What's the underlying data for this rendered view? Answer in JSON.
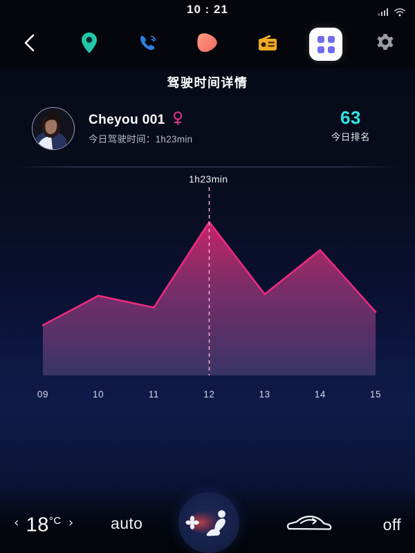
{
  "statusbar": {
    "time": "10 : 21",
    "signal_icon": "signal-bars-icon",
    "wifi_icon": "wifi-icon"
  },
  "topnav": {
    "items": [
      {
        "name": "back",
        "icon": "back-chevron-icon",
        "label": "",
        "color": "#ffffff",
        "active": false
      },
      {
        "name": "navigation",
        "icon": "location-pin-icon",
        "label": "",
        "color": "#22c7a9",
        "active": false
      },
      {
        "name": "phone",
        "icon": "phone-call-icon",
        "label": "",
        "color": "#2f7fe0",
        "active": false
      },
      {
        "name": "music",
        "icon": "music-plectrum-icon",
        "label": "",
        "color": "#f98676",
        "active": false
      },
      {
        "name": "radio",
        "icon": "radio-icon",
        "label": "",
        "color": "#f0ab25",
        "active": false
      },
      {
        "name": "apps",
        "icon": "apps-grid-icon",
        "label": "",
        "color": "#6f6cf0",
        "active": true
      },
      {
        "name": "settings",
        "icon": "gear-icon",
        "label": "",
        "color": "#9a9ba3",
        "active": false
      }
    ]
  },
  "header": {
    "title": "驾驶时间详情"
  },
  "user": {
    "avatar_alt": "user-avatar",
    "name": "Cheyou 001",
    "gender_icon": "female-gender-icon",
    "gender_color": "#e0338c",
    "drive_time_label": "今日驾驶时间：1h23min",
    "rank_value": "63",
    "rank_label": "今日排名",
    "rank_color": "#2fe4e4"
  },
  "chart_data": {
    "type": "area",
    "title": "",
    "xlabel": "",
    "ylabel": "",
    "categories": [
      "09",
      "10",
      "11",
      "12",
      "13",
      "14",
      "15"
    ],
    "values": [
      34,
      54,
      46,
      104,
      55,
      85,
      43
    ],
    "value_unit": "min",
    "ylim": [
      0,
      120
    ],
    "grid": false,
    "legend": false,
    "annotation": {
      "label": "1h23min",
      "at_category": "12",
      "marker": "dashed-vertical-line"
    },
    "line_color": "#ec2a7e",
    "fill_top_color": "#d8256f",
    "fill_bottom_color": "#4a3f72"
  },
  "climate": {
    "temp_prev_icon": "chevron-left-icon",
    "temp_value": "18",
    "temp_unit": "°C",
    "temp_next_icon": "chevron-right-icon",
    "auto_label": "auto",
    "fan_icon": "seat-airflow-icon",
    "recirculation_icon": "car-recirculation-icon",
    "off_label": "off"
  }
}
